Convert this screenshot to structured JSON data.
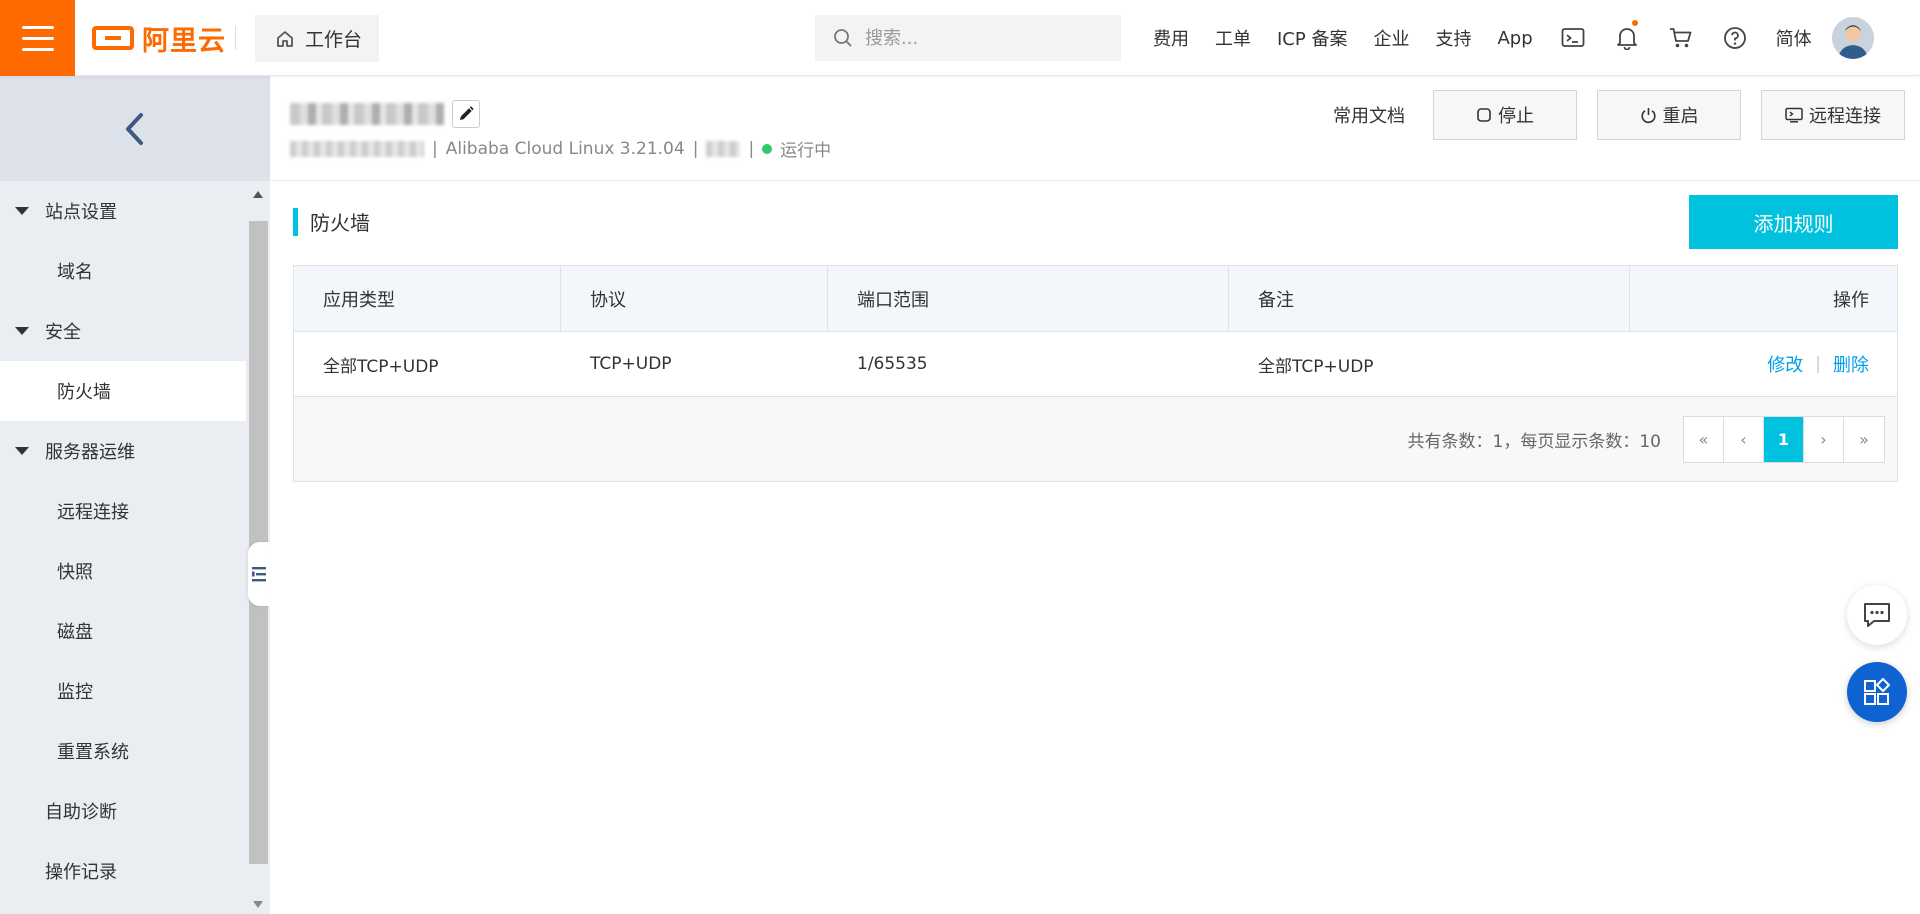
{
  "topbar": {
    "logo_text": "阿里云",
    "workbench_label": "工作台",
    "search_placeholder": "搜索...",
    "nav_links": [
      "费用",
      "工单",
      "ICP 备案",
      "企业",
      "支持",
      "App"
    ],
    "language": "简体",
    "accent_color": "#ff6a00"
  },
  "sidebar": {
    "groups": [
      {
        "label": "站点设置",
        "items": [
          "域名"
        ]
      },
      {
        "label": "安全",
        "items": [
          "防火墙"
        ]
      },
      {
        "label": "服务器运维",
        "items": [
          "远程连接",
          "快照",
          "磁盘",
          "监控",
          "重置系统"
        ]
      }
    ],
    "top_level_items": [
      "自助诊断",
      "操作记录"
    ],
    "active_item": "防火墙"
  },
  "instance": {
    "os": "Alibaba Cloud Linux 3.21.04",
    "status": "运行中",
    "status_color": "#32c86b",
    "docs_label": "常用文档",
    "stop_label": "停止",
    "restart_label": "重启",
    "remote_label": "远程连接"
  },
  "firewall": {
    "title": "防火墙",
    "add_rule_label": "添加规则",
    "columns": [
      "应用类型",
      "协议",
      "端口范围",
      "备注",
      "操作"
    ],
    "rows": [
      {
        "app_type": "全部TCP+UDP",
        "protocol": "TCP+UDP",
        "port_range": "1/65535",
        "note": "全部TCP+UDP",
        "edit_label": "修改",
        "delete_label": "删除"
      }
    ],
    "pagination": {
      "summary": "共有条数：1，每页显示条数：10",
      "first": "«",
      "prev": "‹",
      "current": "1",
      "next": "›",
      "last": "»"
    },
    "accent_color": "#00c1de"
  }
}
